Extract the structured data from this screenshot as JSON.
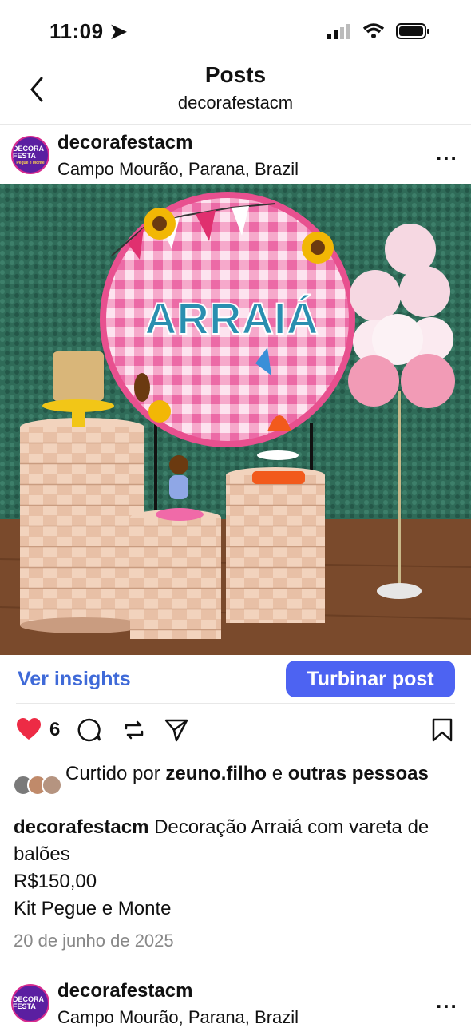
{
  "status_bar": {
    "time": "11:09"
  },
  "nav": {
    "title": "Posts",
    "subtitle": "decorafestacm"
  },
  "post": {
    "account": "decorafestacm",
    "avatar_text": "DECORA FESTA",
    "avatar_subtext": "Pegue e Monte",
    "location": "Campo Mourão, Parana, Brazil",
    "more": "...",
    "photo": {
      "banner_text": "ARRAIÁ",
      "colors": {
        "backdrop": "#2f6b58",
        "panel_pink": "#f06aa8",
        "floor": "#7a4a2c",
        "title_text": "#2a8fb0",
        "balloon_pink": "#f29bb6"
      }
    },
    "insights_label": "Ver insights",
    "boost_label": "Turbinar post",
    "like_count": "6",
    "liked_by_prefix": "Curtido por ",
    "liked_by_user": "zeuno.filho",
    "liked_by_mid": " e ",
    "liked_by_others": "outras pessoas",
    "caption_user": "decorafestacm",
    "caption_text": " Decoração Arraiá com vareta de balões",
    "price": "R$150,00",
    "kit": "Kit Pegue e Monte",
    "date": "20 de junho de 2025"
  },
  "next_post": {
    "account": "decorafestacm",
    "location": "Campo Mourão, Parana, Brazil",
    "avatar_text": "DECORA FESTA",
    "more": "..."
  }
}
